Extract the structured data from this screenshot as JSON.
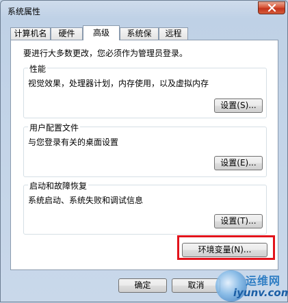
{
  "window": {
    "title": "系统属性"
  },
  "tabs": [
    {
      "label": "计算机名"
    },
    {
      "label": "硬件"
    },
    {
      "label": "高级"
    },
    {
      "label": "系统保护"
    },
    {
      "label": "远程"
    }
  ],
  "active_tab": "高级",
  "intro": "要进行大多数更改，您必须作为管理员登录。",
  "performance": {
    "title": "性能",
    "desc": "视觉效果，处理器计划，内存使用，以及虚拟内存",
    "button": "设置(S)..."
  },
  "user_profiles": {
    "title": "用户配置文件",
    "desc": "与您登录有关的桌面设置",
    "button": "设置(E)..."
  },
  "startup_recovery": {
    "title": "启动和故障恢复",
    "desc": "系统启动、系统失败和调试信息",
    "button": "设置(T)..."
  },
  "env_button": "环境变量(N)...",
  "footer": {
    "ok": "确定",
    "cancel": "取消"
  },
  "watermark": {
    "top": "运维网",
    "bottom": "iyunv.com"
  },
  "colors": {
    "highlight": "#e2131b",
    "close": "#c4341d"
  }
}
